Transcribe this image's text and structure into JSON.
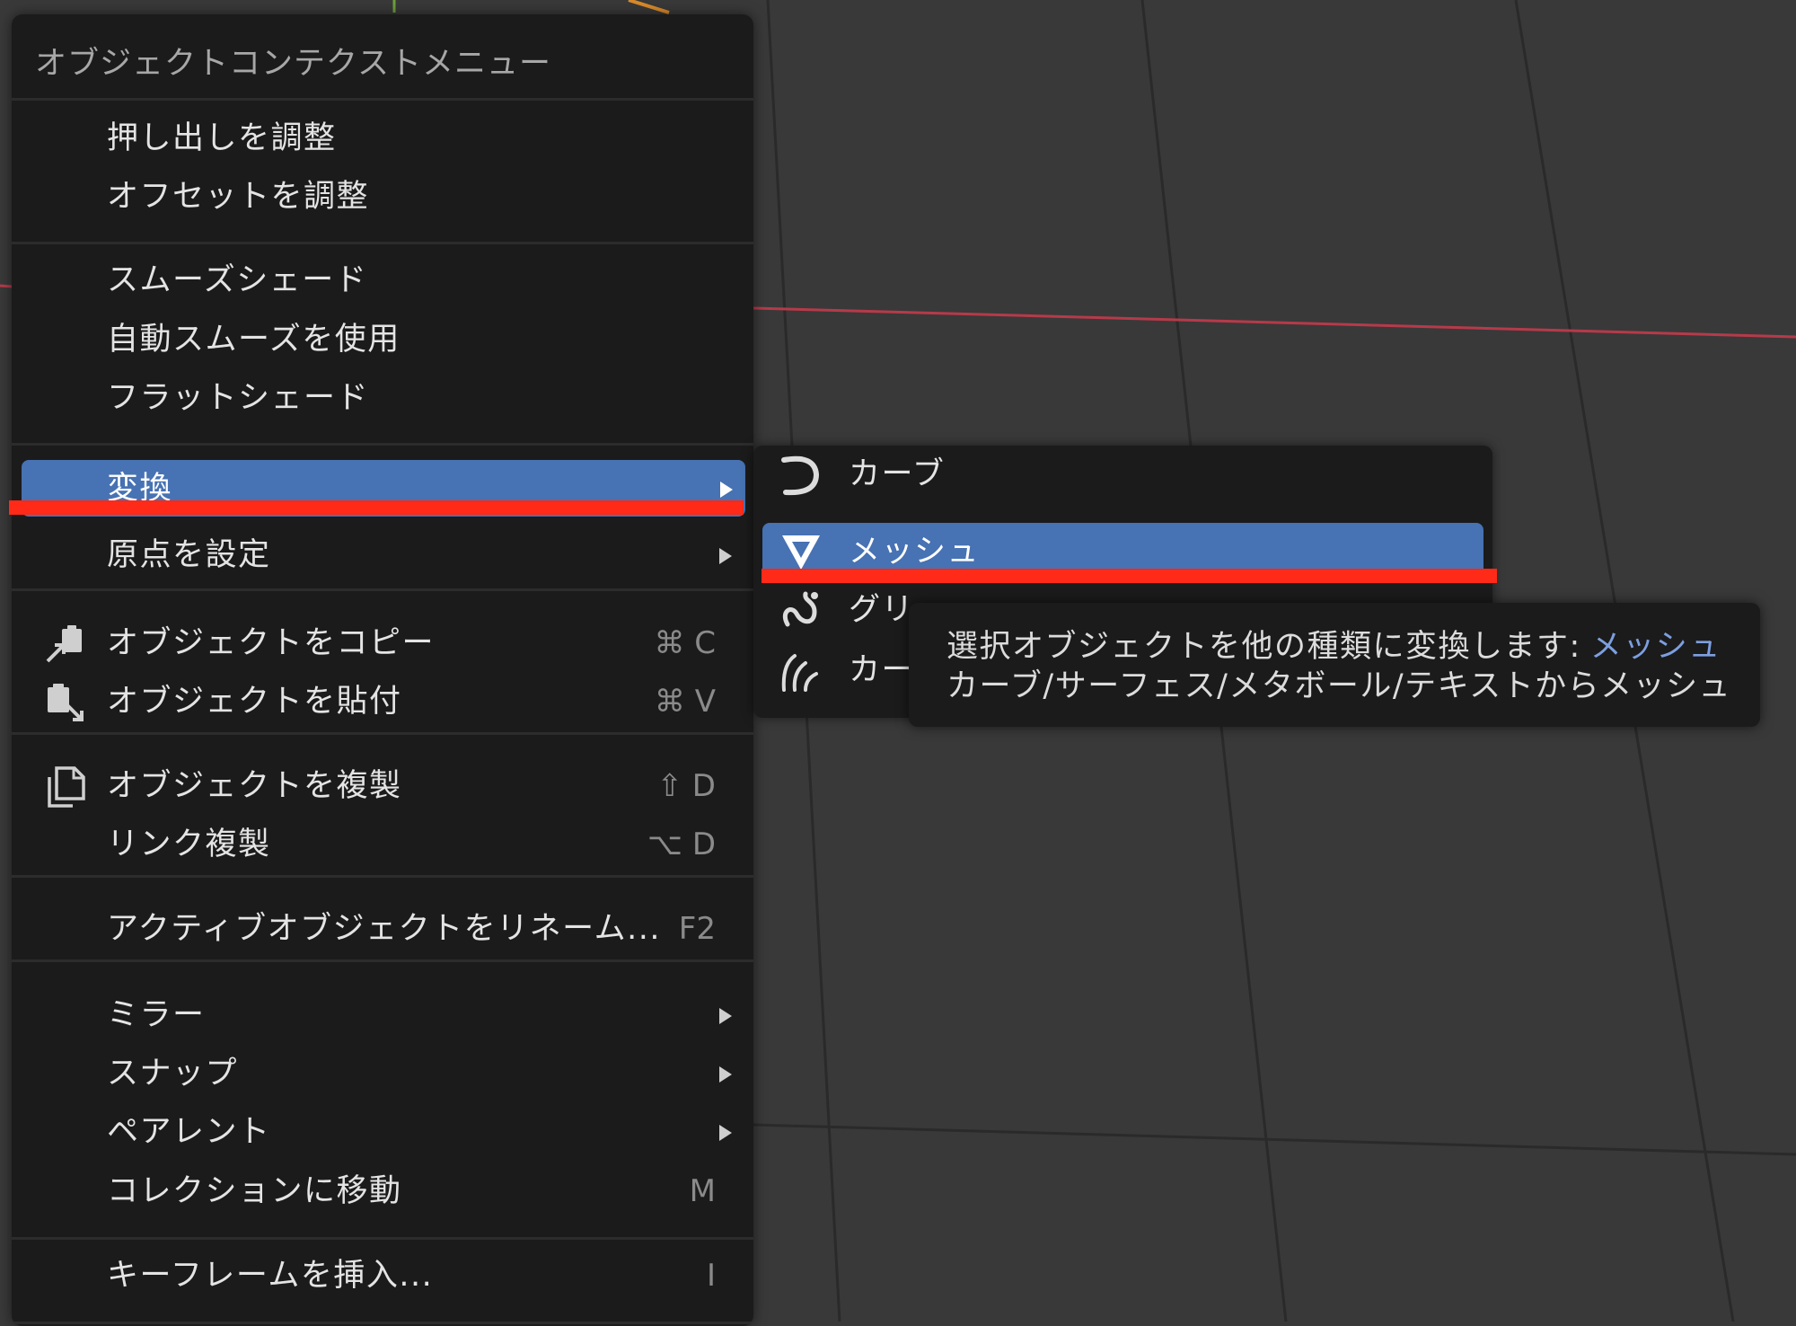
{
  "menu": {
    "title": "オブジェクトコンテクストメニュー",
    "items": [
      {
        "label": "押し出しを調整"
      },
      {
        "label": "オフセットを調整"
      },
      {
        "label": "スムーズシェード"
      },
      {
        "label": "自動スムーズを使用"
      },
      {
        "label": "フラットシェード"
      },
      {
        "label": "変換",
        "submenu": true,
        "active": true
      },
      {
        "label": "原点を設定",
        "submenu": true
      },
      {
        "label": "オブジェクトをコピー",
        "shortcut": "⌘ C",
        "icon": "copy-object-icon"
      },
      {
        "label": "オブジェクトを貼付",
        "shortcut": "⌘ V",
        "icon": "paste-object-icon"
      },
      {
        "label": "オブジェクトを複製",
        "shortcut": "⇧ D",
        "icon": "duplicate-icon"
      },
      {
        "label": "リンク複製",
        "shortcut": "⌥ D"
      },
      {
        "label": "アクティブオブジェクトをリネーム...",
        "shortcut": "F2"
      },
      {
        "label": "ミラー",
        "submenu": true
      },
      {
        "label": "スナップ",
        "submenu": true
      },
      {
        "label": "ペアレント",
        "submenu": true
      },
      {
        "label": "コレクションに移動",
        "shortcut": "M"
      },
      {
        "label": "キーフレームを挿入...",
        "shortcut": "I"
      }
    ]
  },
  "submenu": {
    "items": [
      {
        "label": "カーブ",
        "icon": "curve-icon"
      },
      {
        "label": "メッシュ",
        "icon": "mesh-icon",
        "active": true
      },
      {
        "label": "グリ",
        "icon": "grease-pencil-icon"
      },
      {
        "label": "カー",
        "icon": "curves-icon"
      }
    ]
  },
  "tooltip": {
    "line1": "選択オブジェクトを他の種類に変換します:",
    "line1_highlight": "メッシュ",
    "line2": "カーブ/サーフェス/メタボール/テキストからメッシュ"
  },
  "colors": {
    "menu_bg": "#1b1b1b",
    "highlight": "#4772b3",
    "annotation_red": "#ff2a17",
    "viewport_bg": "#393939",
    "x_axis": "#b63a4a"
  }
}
